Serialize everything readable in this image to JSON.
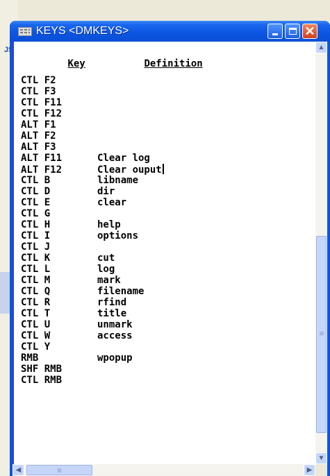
{
  "window": {
    "title": "KEYS <DMKEYS>",
    "icon": "sas-keys-icon"
  },
  "background": {
    "partial_text": "JS"
  },
  "header": {
    "key": "Key",
    "definition": "Definition"
  },
  "rows": [
    {
      "key": "CTL F2",
      "def": ""
    },
    {
      "key": "CTL F3",
      "def": ""
    },
    {
      "key": "CTL F11",
      "def": ""
    },
    {
      "key": "CTL F12",
      "def": ""
    },
    {
      "key": "ALT F1",
      "def": ""
    },
    {
      "key": "ALT F2",
      "def": ""
    },
    {
      "key": "ALT F3",
      "def": ""
    },
    {
      "key": "ALT F11",
      "def": "Clear log"
    },
    {
      "key": "ALT F12",
      "def": "Clear ouput"
    },
    {
      "key": "CTL B",
      "def": "libname"
    },
    {
      "key": "CTL D",
      "def": "dir"
    },
    {
      "key": "CTL E",
      "def": "clear"
    },
    {
      "key": "CTL G",
      "def": ""
    },
    {
      "key": "CTL H",
      "def": "help"
    },
    {
      "key": "CTL I",
      "def": "options"
    },
    {
      "key": "CTL J",
      "def": ""
    },
    {
      "key": "CTL K",
      "def": "cut"
    },
    {
      "key": "CTL L",
      "def": "log"
    },
    {
      "key": "CTL M",
      "def": "mark"
    },
    {
      "key": "CTL Q",
      "def": "filename"
    },
    {
      "key": "CTL R",
      "def": "rfind"
    },
    {
      "key": "CTL T",
      "def": "title"
    },
    {
      "key": "CTL U",
      "def": "unmark"
    },
    {
      "key": "CTL W",
      "def": "access"
    },
    {
      "key": "CTL Y",
      "def": ""
    },
    {
      "key": "RMB",
      "def": "wpopup"
    },
    {
      "key": "SHF RMB",
      "def": ""
    },
    {
      "key": "CTL RMB",
      "def": ""
    }
  ],
  "colors": {
    "titlebar": "#0a56e0",
    "close_button": "#d3401c",
    "text": "#000000"
  }
}
